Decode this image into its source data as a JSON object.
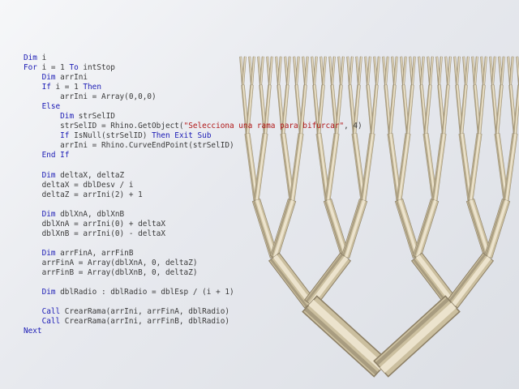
{
  "code_lines": [
    [
      {
        "t": "Dim",
        "k": true
      },
      {
        "t": " i"
      }
    ],
    [
      {
        "t": "For",
        "k": true
      },
      {
        "t": " i = 1 "
      },
      {
        "t": "To",
        "k": true
      },
      {
        "t": " intStop"
      }
    ],
    [
      {
        "t": "    "
      },
      {
        "t": "Dim",
        "k": true
      },
      {
        "t": " arrIni"
      }
    ],
    [
      {
        "t": "    "
      },
      {
        "t": "If",
        "k": true
      },
      {
        "t": " i = 1 "
      },
      {
        "t": "Then",
        "k": true
      }
    ],
    [
      {
        "t": "        arrIni = Array(0,0,0)"
      }
    ],
    [
      {
        "t": "    "
      },
      {
        "t": "Else",
        "k": true
      }
    ],
    [
      {
        "t": "        "
      },
      {
        "t": "Dim",
        "k": true
      },
      {
        "t": " strSelID"
      }
    ],
    [
      {
        "t": "        strSelID = Rhino.GetObject("
      },
      {
        "t": "\"Selecciona una rama para bifurcar\"",
        "s": true
      },
      {
        "t": ", 4)"
      }
    ],
    [
      {
        "t": "        "
      },
      {
        "t": "If",
        "k": true
      },
      {
        "t": " IsNull(strSelID) "
      },
      {
        "t": "Then",
        "k": true
      },
      {
        "t": " "
      },
      {
        "t": "Exit",
        "k": true
      },
      {
        "t": " "
      },
      {
        "t": "Sub",
        "k": true
      }
    ],
    [
      {
        "t": "        arrIni = Rhino.CurveEndPoint(strSelID)"
      }
    ],
    [
      {
        "t": "    "
      },
      {
        "t": "End",
        "k": true
      },
      {
        "t": " "
      },
      {
        "t": "If",
        "k": true
      }
    ],
    [],
    [
      {
        "t": "    "
      },
      {
        "t": "Dim",
        "k": true
      },
      {
        "t": " deltaX, deltaZ"
      }
    ],
    [
      {
        "t": "    deltaX = dblDesv / i"
      }
    ],
    [
      {
        "t": "    deltaZ = arrIni(2) + 1"
      }
    ],
    [],
    [
      {
        "t": "    "
      },
      {
        "t": "Dim",
        "k": true
      },
      {
        "t": " dblXnA, dblXnB"
      }
    ],
    [
      {
        "t": "    dblXnA = arrIni(0) + deltaX"
      }
    ],
    [
      {
        "t": "    dblXnB = arrIni(0) - deltaX"
      }
    ],
    [],
    [
      {
        "t": "    "
      },
      {
        "t": "Dim",
        "k": true
      },
      {
        "t": " arrFinA, arrFinB"
      }
    ],
    [
      {
        "t": "    arrFinA = Array(dblXnA, 0, deltaZ)"
      }
    ],
    [
      {
        "t": "    arrFinB = Array(dblXnB, 0, deltaZ)"
      }
    ],
    [],
    [
      {
        "t": "    "
      },
      {
        "t": "Dim",
        "k": true
      },
      {
        "t": " dblRadio : dblRadio = dblEsp / (i + 1)"
      }
    ],
    [],
    [
      {
        "t": "    "
      },
      {
        "t": "Call",
        "k": true
      },
      {
        "t": " CrearRama(arrIni, arrFinA, dblRadio)"
      }
    ],
    [
      {
        "t": "    "
      },
      {
        "t": "Call",
        "k": true
      },
      {
        "t": " CrearRama(arrIni, arrFinB, dblRadio)"
      }
    ],
    [
      {
        "t": "Next",
        "k": true
      }
    ]
  ],
  "colors": {
    "background": "#e7e9ee",
    "keyword": "#1b1bb5",
    "string": "#b01515",
    "code_text": "#3a3a3a",
    "branch_light": "#ece3cd",
    "branch_mid": "#cbbf9f",
    "branch_dark": "#8d8066"
  }
}
